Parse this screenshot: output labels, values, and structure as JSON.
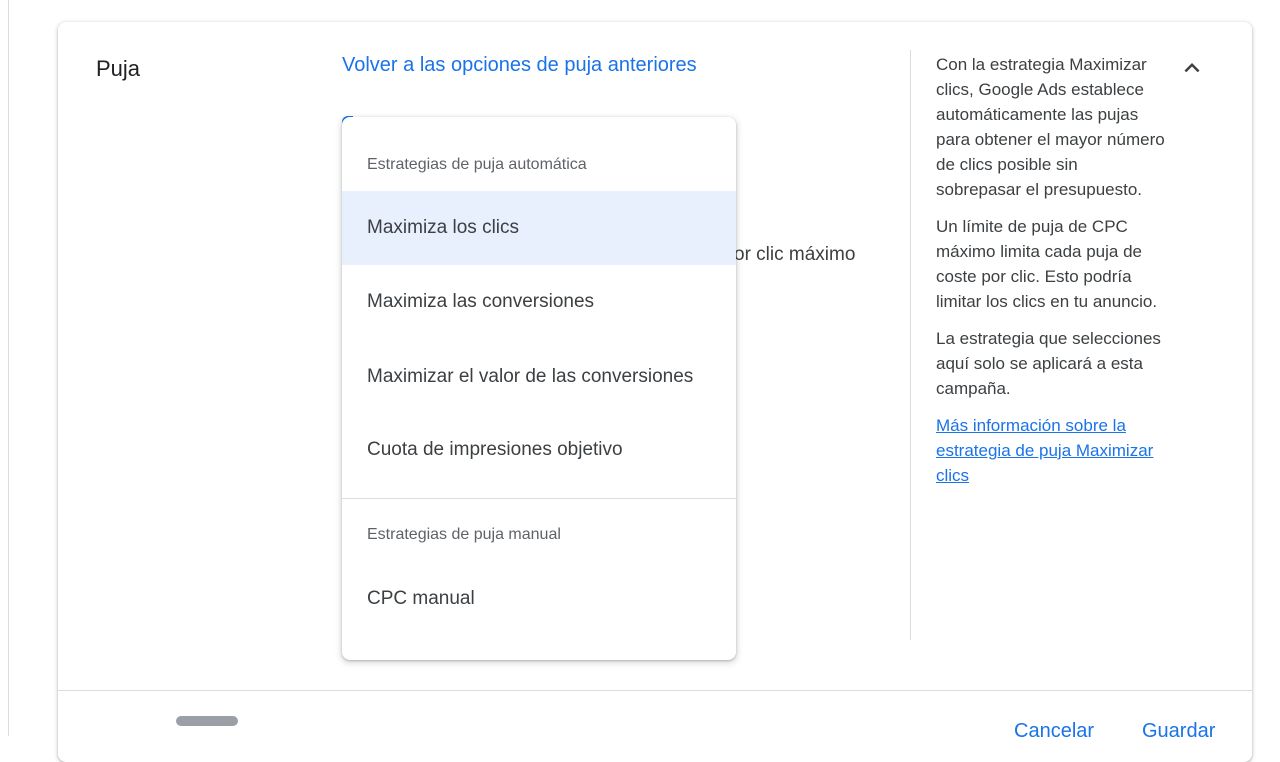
{
  "section": {
    "title": "Puja",
    "back_link": "Volver a las opciones de puja anteriores",
    "behind_text": "or clic máximo"
  },
  "dropdown": {
    "automatic_group_label": "Estrategias de puja automática",
    "automatic_items": [
      {
        "label": "Maximiza los clics",
        "selected": true
      },
      {
        "label": "Maximiza las conversiones",
        "selected": false
      },
      {
        "label": "Maximizar el valor de las conversiones",
        "selected": false
      },
      {
        "label": "Cuota de impresiones objetivo",
        "selected": false
      }
    ],
    "manual_group_label": "Estrategias de puja manual",
    "manual_items": [
      {
        "label": "CPC manual",
        "selected": false
      }
    ]
  },
  "help": {
    "paragraph1": "Con la estrategia Maximizar clics, Google Ads establece automáticamente las pujas para obtener el mayor número de clics posible sin sobrepasar el presupuesto.",
    "paragraph2": "Un límite de puja de CPC máximo limita cada puja de coste por clic. Esto podría limitar los clics en tu anuncio.",
    "paragraph3": "La estrategia que selecciones aquí solo se aplicará a esta campaña.",
    "learn_more_link": "Más información sobre la estrategia de puja Maximizar clics"
  },
  "icons": {
    "collapse": "chevron-up-icon"
  },
  "footer": {
    "cancel_label": "Cancelar",
    "save_label": "Guardar"
  },
  "colors": {
    "accent": "#1a73e8",
    "selected_background": "#e8f0fe"
  }
}
